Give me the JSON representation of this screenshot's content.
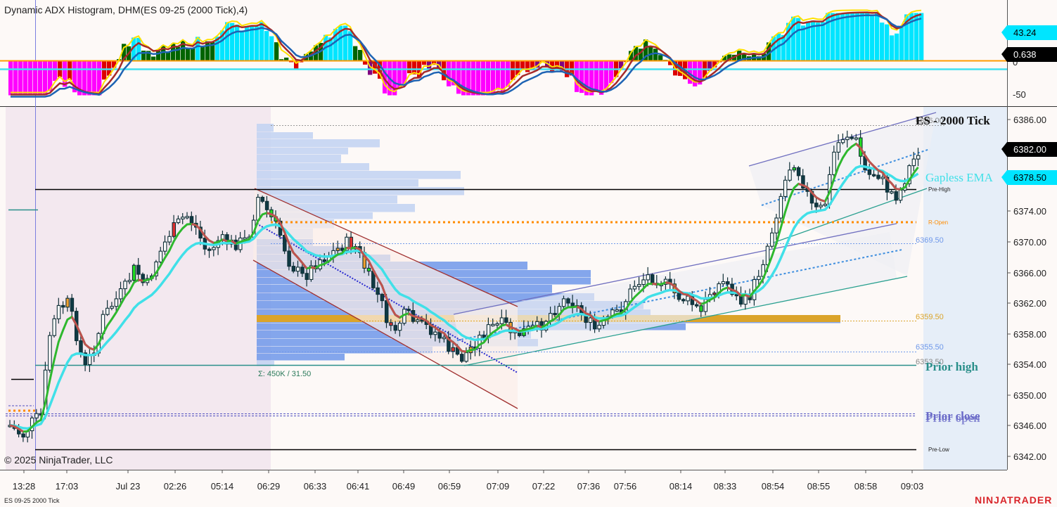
{
  "window": {
    "indicator_title": "Dynamic ADX Histogram, DHM(ES 09-25 (2000 Tick),4)",
    "copyright": "© 2025 NinjaTrader, LLC",
    "instrument_footer": "ES 09-25 2000 Tick",
    "brand": "NINJATRADER",
    "main_title": "ES - 2000 Tick"
  },
  "indicator_panel": {
    "axis_labels": [
      "0",
      "-50"
    ],
    "badges": [
      {
        "text": "43.24",
        "color": "#00e5ff",
        "text_color": "#000000"
      },
      {
        "text": "0.638",
        "color": "#000000",
        "text_color": "#ffffff"
      }
    ]
  },
  "price_axis": {
    "labels": [
      "6386.00",
      "6382.00",
      "6378.50",
      "6374.00",
      "6370.00",
      "6366.00",
      "6362.00",
      "6358.00",
      "6354.00",
      "6350.00",
      "6346.00",
      "6342.00"
    ],
    "badges": [
      {
        "text": "6382.00",
        "color": "#000000",
        "text_color": "#ffffff"
      },
      {
        "text": "6378.50",
        "color": "#00e5ff",
        "text_color": "#000000"
      }
    ]
  },
  "time_axis": {
    "labels": [
      "13:28",
      "17:03",
      "Jul 23",
      "02:26",
      "05:14",
      "06:29",
      "06:33",
      "06:41",
      "06:49",
      "06:59",
      "07:09",
      "07:22",
      "07:36",
      "07:56",
      "08:14",
      "08:33",
      "08:54",
      "08:55",
      "08:58",
      "09:03"
    ]
  },
  "annotations": {
    "ema_label": "Gapless EMA",
    "prior_high": "Prior high",
    "prior_close": "Prior close",
    "prior_open": "Prior open",
    "pre_high": "Pre-High",
    "r_open": "R-Open",
    "pre_low": "Pre-Low",
    "vp_summary": "Σ: 450K / 31.50",
    "level_6369": "6369.50",
    "level_6359": "6359.50",
    "level_6355": "6355.50",
    "level_6353": "6353.50",
    "level_top": "6386.00"
  },
  "colors": {
    "bull": "#006400",
    "bear": "#dd0000",
    "strong_bull": "#00e5ff",
    "strong_bear": "#ff00ff",
    "ema": "#40e0e8",
    "poc": "#dba42a",
    "va": "#6f98ea"
  }
}
